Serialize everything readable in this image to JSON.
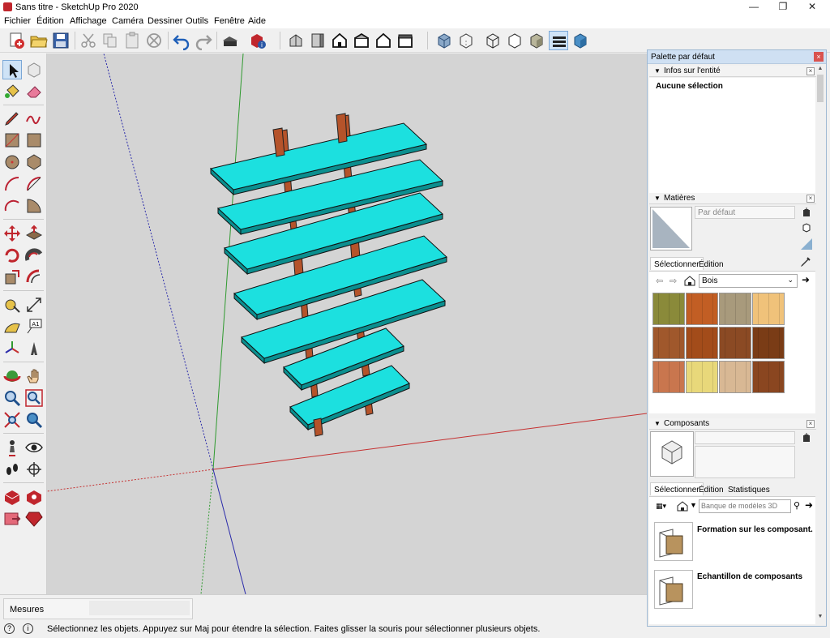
{
  "window": {
    "title": "Sans titre - SketchUp Pro 2020",
    "controls": [
      "minimize",
      "restore",
      "close"
    ]
  },
  "menu": [
    {
      "label": "Fichier"
    },
    {
      "label": "Édition"
    },
    {
      "label": "Affichage"
    },
    {
      "label": "Caméra"
    },
    {
      "label": "Dessiner"
    },
    {
      "label": "Outils"
    },
    {
      "label": "Fenêtre"
    },
    {
      "label": "Aide"
    }
  ],
  "toolbar": {
    "icons": [
      "new-file-icon",
      "open-folder-icon",
      "save-icon",
      "cut-icon",
      "copy-icon",
      "paste-icon",
      "erase-icon",
      "undo-icon",
      "redo-icon",
      "print-icon",
      "model-info-icon",
      "iso-view-icon",
      "top-view-icon",
      "front-view-icon",
      "right-view-icon",
      "back-view-icon",
      "left-view-icon",
      "xray-icon",
      "back-edges-icon",
      "wireframe-icon",
      "hidden-line-icon",
      "shaded-icon",
      "shaded-textures-icon",
      "monochrome-icon"
    ]
  },
  "left_tools": [
    "select",
    "make-component",
    "paint-bucket",
    "eraser",
    "pencil-line",
    "freehand",
    "rectangle",
    "rotated-rectangle",
    "circle",
    "polygon",
    "arc",
    "pie",
    "arc-2pt",
    "arc-3pt",
    "move",
    "push-pull",
    "rotate",
    "follow-me",
    "scale",
    "offset",
    "tape-measure",
    "dimension",
    "protractor",
    "text",
    "axes",
    "3d-text",
    "orbit",
    "pan",
    "zoom",
    "zoom-window",
    "zoom-extents",
    "previous-view",
    "position-camera",
    "look-around",
    "walk",
    "section-plane",
    "3d-warehouse",
    "extension-warehouse",
    "layout",
    "ruby"
  ],
  "colors": {
    "shelf_top": "#1ce0df",
    "shelf_edge": "#0b8f8f",
    "post": "#b5532a",
    "viewport_bg": "#d4d4d4",
    "axis_red": "#c53030",
    "axis_green": "#2f9a2f",
    "axis_blue": "#2b2baa"
  },
  "measures": {
    "label": "Mesures"
  },
  "status": {
    "message": "Sélectionnez les objets. Appuyez sur Maj pour étendre la sélection. Faites glisser la souris pour sélectionner plusieurs objets."
  },
  "tray": {
    "title": "Palette par défaut",
    "entity_info": {
      "header": "Infos sur l'entité",
      "text": "Aucune sélection"
    },
    "materials": {
      "header": "Matières",
      "name_placeholder": "Par défaut",
      "tabs": [
        "Sélectionner",
        "Édition"
      ],
      "library": "Bois",
      "swatches": [
        {
          "color": "#8a8a3a"
        },
        {
          "color": "#c25e24"
        },
        {
          "color": "#a89a7c"
        },
        {
          "color": "#f0c27a"
        },
        {
          "color": "#a0582c"
        },
        {
          "color": "#a34c1a"
        },
        {
          "color": "#8b4a24"
        },
        {
          "color": "#7a3c16"
        },
        {
          "color": "#c9764e"
        },
        {
          "color": "#e8d87a"
        },
        {
          "color": "#d8b894"
        },
        {
          "color": "#8a4620"
        }
      ]
    },
    "components": {
      "header": "Composants",
      "tabs": [
        "Sélectionner",
        "Édition",
        "Statistiques"
      ],
      "search_placeholder": "Banque de modèles 3D",
      "items": [
        {
          "name": "Formation sur les composant..."
        },
        {
          "name": "Échantillon de composants"
        }
      ]
    }
  }
}
